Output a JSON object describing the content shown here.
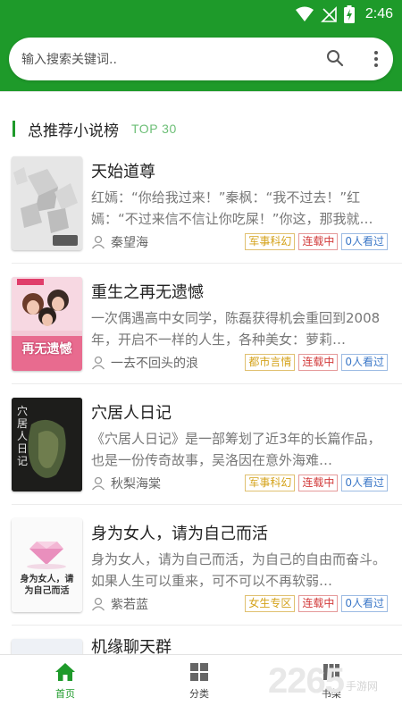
{
  "status_bar": {
    "time": "2:46"
  },
  "search": {
    "placeholder": "输入搜索关键词.."
  },
  "section": {
    "title": "总推荐小说榜",
    "subtitle": "TOP 30"
  },
  "books": [
    {
      "title": "天始道尊",
      "description": "红嫣：“你给我过来！”秦枫：“我不过去！”红嫣：“不过来信不信让你吃屎！”你这，那我就…",
      "author": "秦望海",
      "category": "军事科幻",
      "status": "连载中",
      "reads": "0人看过"
    },
    {
      "title": "重生之再无遗憾",
      "description": "一次偶遇高中女同学，陈磊获得机会重回到2008年，开启不一样的人生，各种美女：萝莉…",
      "author": "一去不回头的浪",
      "category": "都市言情",
      "status": "连载中",
      "reads": "0人看过",
      "cover_text": "再无遗憾"
    },
    {
      "title": "穴居人日记",
      "description": "《穴居人日记》是一部筹划了近3年的长篇作品，也是一份传奇故事，吴洛因在意外海难…",
      "author": "秋梨海棠",
      "category": "军事科幻",
      "status": "连载中",
      "reads": "0人看过",
      "cover_text": "穴居人日记"
    },
    {
      "title": "身为女人，请为自己而活",
      "description": "身为女人，请为自己而活，为自己的自由而奋斗。如果人生可以重来，可不可以不再软弱…",
      "author": "紫若蓝",
      "category": "女生专区",
      "status": "连载中",
      "reads": "0人看过",
      "cover_text": "身为女人，请为自己而活"
    },
    {
      "title": "机缘聊天群"
    }
  ],
  "nav": [
    {
      "label": "首页",
      "icon": "home-icon"
    },
    {
      "label": "分类",
      "icon": "grid-icon"
    },
    {
      "label": "书架",
      "icon": "bookshelf-icon"
    }
  ],
  "watermark": {
    "number": "2265",
    "text": "手游网"
  },
  "colors": {
    "primary": "#1e9a2a",
    "tag_category": "#d4a21a",
    "tag_status": "#d23a3a",
    "tag_reads": "#3c78c8"
  }
}
